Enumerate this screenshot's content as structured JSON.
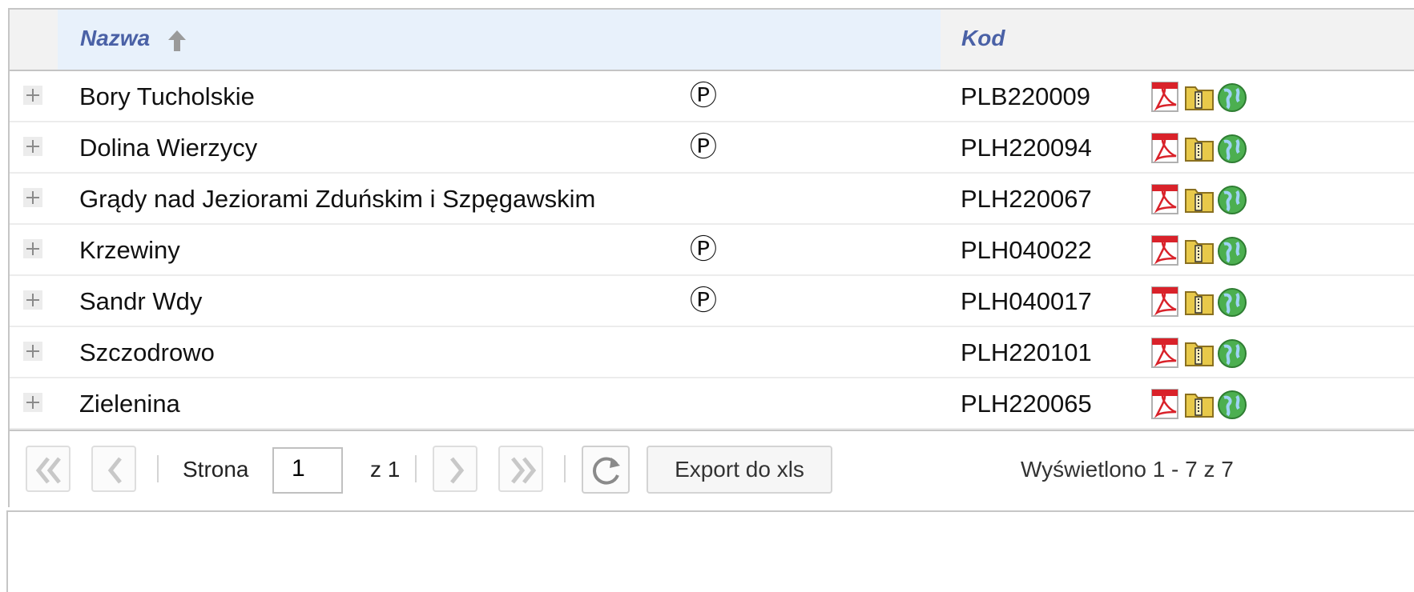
{
  "grid": {
    "columns": {
      "name_header": "Nazwa",
      "code_header": "Kod",
      "sort_direction": "ascending"
    },
    "rows": [
      {
        "name": "Bory Tucholskie",
        "flag": "Ⓟ",
        "code": "PLB220009"
      },
      {
        "name": "Dolina Wierzycy",
        "flag": "Ⓟ",
        "code": "PLH220094"
      },
      {
        "name": "Grądy nad Jeziorami Zduńskim i Szpęgawskim",
        "flag": "",
        "code": "PLH220067"
      },
      {
        "name": "Krzewiny",
        "flag": "Ⓟ",
        "code": "PLH040022"
      },
      {
        "name": "Sandr Wdy",
        "flag": "Ⓟ",
        "code": "PLH040017"
      },
      {
        "name": "Szczodrowo",
        "flag": "",
        "code": "PLH220101"
      },
      {
        "name": "Zielenina",
        "flag": "",
        "code": "PLH220065"
      }
    ],
    "row_icons": [
      "pdf-icon",
      "zip-folder-icon",
      "globe-icon"
    ]
  },
  "pager": {
    "page_label": "Strona",
    "page_value": "1",
    "of_label": "z 1",
    "export_label": "Export do xls",
    "status_text": "Wyświetlono 1 - 7 z 7"
  },
  "colors": {
    "header_text": "#4a61a6",
    "sorted_header_bg": "#e8f1fb",
    "pdf_red": "#d9222a",
    "zip_yellow": "#e8c94a",
    "globe_green": "#4caf50"
  }
}
